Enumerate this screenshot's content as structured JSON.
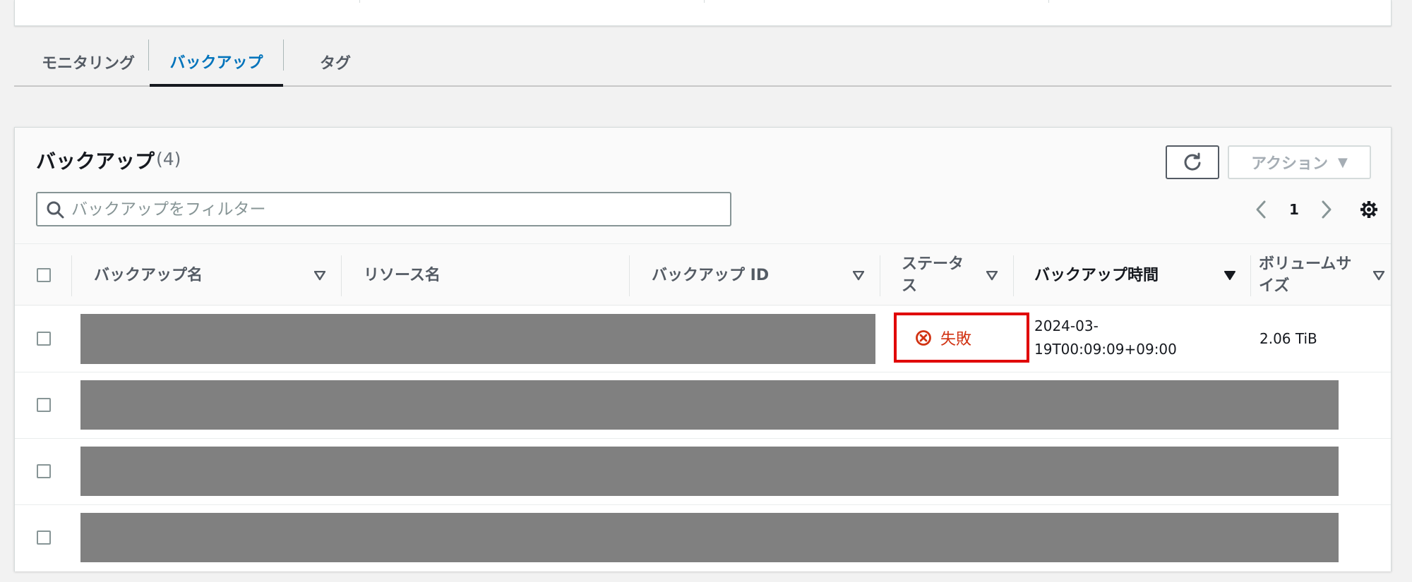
{
  "tabs": [
    {
      "label": "モニタリング"
    },
    {
      "label": "バックアップ"
    },
    {
      "label": "タグ"
    }
  ],
  "panel": {
    "title": "バックアップ",
    "count": "(4)",
    "action_label": "アクション",
    "search_placeholder": "バックアップをフィルター",
    "page": "1"
  },
  "columns": [
    {
      "label": "バックアップ名"
    },
    {
      "label": "リソース名"
    },
    {
      "label": "バックアップ ID"
    },
    {
      "label": "ステータス",
      "line1": "ステータ",
      "line2": "ス"
    },
    {
      "label": "バックアップ時間"
    },
    {
      "label": "ボリュームサイズ",
      "line1": "ボリュームサ",
      "line2": "イズ"
    }
  ],
  "rows": [
    {
      "status": "失敗",
      "time_line1": "2024-03-",
      "time_line2": "19T00:09:09+09:00",
      "size": "2.06 TiB"
    }
  ],
  "colors": {
    "accent": "#0073bb",
    "error": "#d13212",
    "highlight_border": "#e00000",
    "redaction": "#808080"
  }
}
